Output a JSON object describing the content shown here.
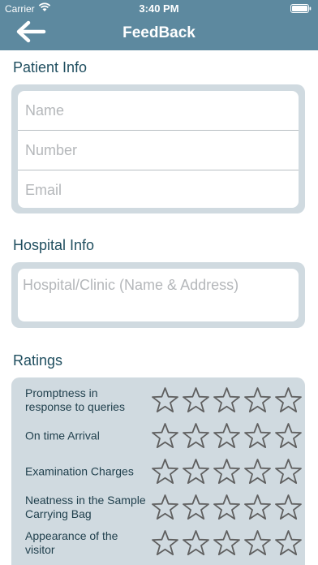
{
  "status_bar": {
    "carrier": "Carrier",
    "time": "3:40 PM"
  },
  "header": {
    "title": "FeedBack",
    "back_icon": "arrow-left-icon"
  },
  "patient_info": {
    "title": "Patient Info",
    "fields": [
      {
        "placeholder": "Name",
        "value": ""
      },
      {
        "placeholder": "Number",
        "value": ""
      },
      {
        "placeholder": "Email",
        "value": ""
      }
    ]
  },
  "hospital_info": {
    "title": "Hospital Info",
    "field": {
      "placeholder": "Hospital/Clinic (Name & Address)",
      "value": ""
    }
  },
  "ratings": {
    "title": "Ratings",
    "max_stars": 5,
    "items": [
      {
        "label": "Promptness in response to queries",
        "value": 0
      },
      {
        "label": "On time Arrival",
        "value": 0
      },
      {
        "label": "Examination Charges",
        "value": 0
      },
      {
        "label": "Neatness in the Sample Carrying Bag",
        "value": 0
      },
      {
        "label": "Appearance of the visitor",
        "value": 0
      }
    ]
  },
  "colors": {
    "header_bg": "#5d899f",
    "card_bg": "#d0dae0",
    "section_title": "#1f4e5f"
  }
}
